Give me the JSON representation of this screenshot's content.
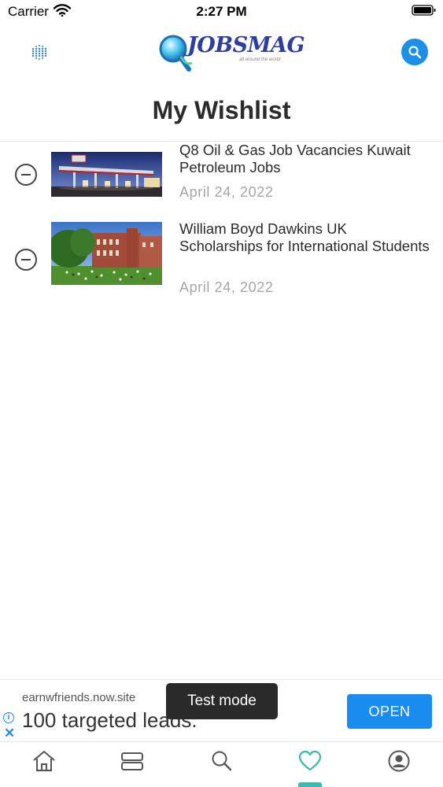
{
  "status_bar": {
    "carrier": "Carrier",
    "time": "2:27 PM"
  },
  "header": {
    "logo_text": "JOBSMAG",
    "logo_tagline": "all around the world"
  },
  "page": {
    "title": "My Wishlist"
  },
  "wishlist": [
    {
      "title": "Q8 Oil & Gas Job Vacancies Kuwait Petroleum Jobs",
      "date": "April 24, 2022",
      "thumbnail": "gas-station"
    },
    {
      "title": "William Boyd Dawkins UK Scholarships for International Students",
      "date": "April 24, 2022",
      "thumbnail": "university-building"
    }
  ],
  "ad": {
    "domain": "earnwfriends.now.site",
    "headline": "100 targeted leads.",
    "open_label": "OPEN",
    "info_icon": "info-icon",
    "close_icon": "close-icon"
  },
  "toast": {
    "text": "Test mode"
  },
  "tab_bar": {
    "tabs": [
      {
        "icon": "home-icon"
      },
      {
        "icon": "list-icon"
      },
      {
        "icon": "search-icon"
      },
      {
        "icon": "heart-icon",
        "active": true
      },
      {
        "icon": "profile-icon"
      }
    ]
  },
  "colors": {
    "accent_blue": "#1e8fe8",
    "active_tab": "#3fb8b2",
    "text_dark": "#2b2b2b",
    "date_gray": "#a6a6a6"
  }
}
